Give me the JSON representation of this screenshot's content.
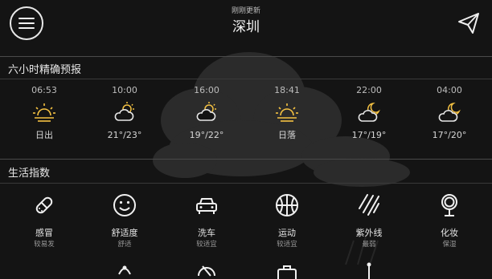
{
  "header": {
    "subtitle": "刚刚更新",
    "city": "深圳",
    "menu_icon": "menu-icon",
    "share_icon": "paper-plane-icon"
  },
  "forecast": {
    "title": "六小时精确预报",
    "items": [
      {
        "time": "06:53",
        "icon": "sunrise-icon",
        "label": "日出"
      },
      {
        "time": "10:00",
        "icon": "cloudy-sun-icon",
        "label": "21°/23°"
      },
      {
        "time": "16:00",
        "icon": "cloudy-sun-icon",
        "label": "19°/22°"
      },
      {
        "time": "18:41",
        "icon": "sunset-icon",
        "label": "日落"
      },
      {
        "time": "22:00",
        "icon": "cloudy-moon-icon",
        "label": "17°/19°"
      },
      {
        "time": "04:00",
        "icon": "cloudy-moon-icon",
        "label": "17°/20°"
      }
    ]
  },
  "life": {
    "title": "生活指数",
    "items": [
      {
        "name": "感冒",
        "level": "较易发",
        "icon": "pill-icon"
      },
      {
        "name": "舒适度",
        "level": "舒适",
        "icon": "smiley-icon"
      },
      {
        "name": "洗车",
        "level": "较适宜",
        "icon": "car-icon"
      },
      {
        "name": "运动",
        "level": "较适宜",
        "icon": "basketball-icon"
      },
      {
        "name": "紫外线",
        "level": "最弱",
        "icon": "uv-rays-icon"
      },
      {
        "name": "化妆",
        "level": "保湿",
        "icon": "mirror-icon"
      }
    ]
  },
  "colors": {
    "background": "#141414",
    "sun": "#f5c242",
    "text": "#e6e6e6"
  }
}
